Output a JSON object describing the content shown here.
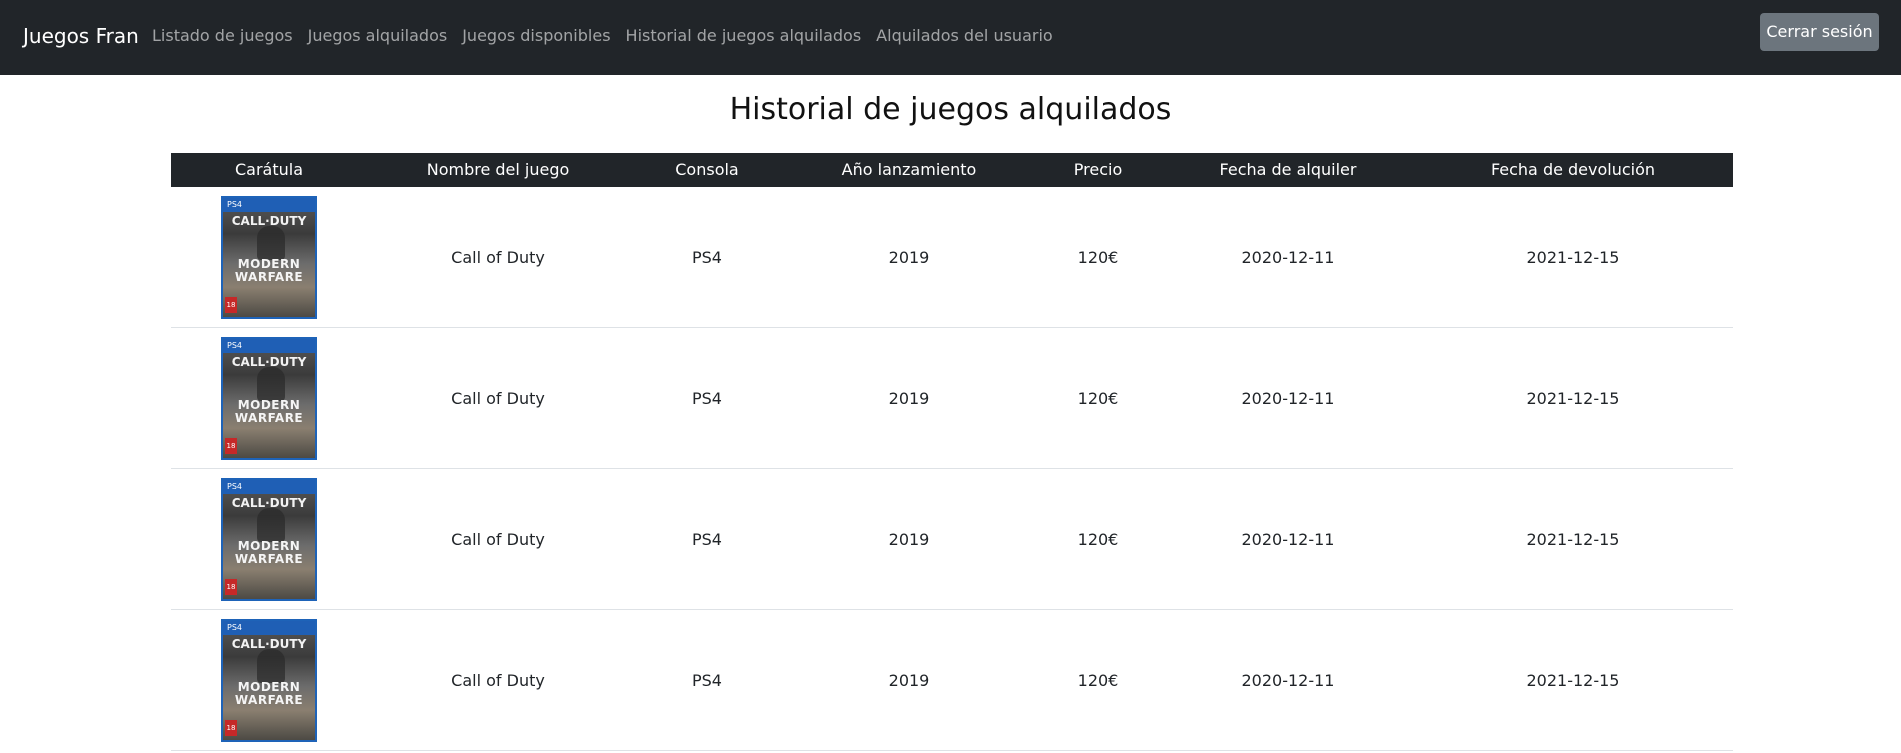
{
  "navbar": {
    "brand": "Juegos Fran",
    "links": [
      "Listado de juegos",
      "Juegos alquilados",
      "Juegos disponibles",
      "Historial de juegos alquilados",
      "Alquilados del usuario"
    ],
    "logout_label": "Cerrar sesión"
  },
  "page": {
    "title": "Historial de juegos alquilados"
  },
  "table": {
    "headers": [
      "Carátula",
      "Nombre del juego",
      "Consola",
      "Año lanzamiento",
      "Precio",
      "Fecha de alquiler",
      "Fecha de devolución"
    ],
    "cover_art": {
      "platform": "PS4",
      "title_line1": "CALL·DUTY",
      "title_line2": "MODERN WARFARE",
      "rating": "18"
    },
    "rows": [
      {
        "name": "Call of Duty",
        "console": "PS4",
        "year": "2019",
        "price": "120€",
        "rented": "2020-12-11",
        "returned": "2021-12-15"
      },
      {
        "name": "Call of Duty",
        "console": "PS4",
        "year": "2019",
        "price": "120€",
        "rented": "2020-12-11",
        "returned": "2021-12-15"
      },
      {
        "name": "Call of Duty",
        "console": "PS4",
        "year": "2019",
        "price": "120€",
        "rented": "2020-12-11",
        "returned": "2021-12-15"
      },
      {
        "name": "Call of Duty",
        "console": "PS4",
        "year": "2019",
        "price": "120€",
        "rented": "2020-12-11",
        "returned": "2021-12-15"
      }
    ]
  }
}
